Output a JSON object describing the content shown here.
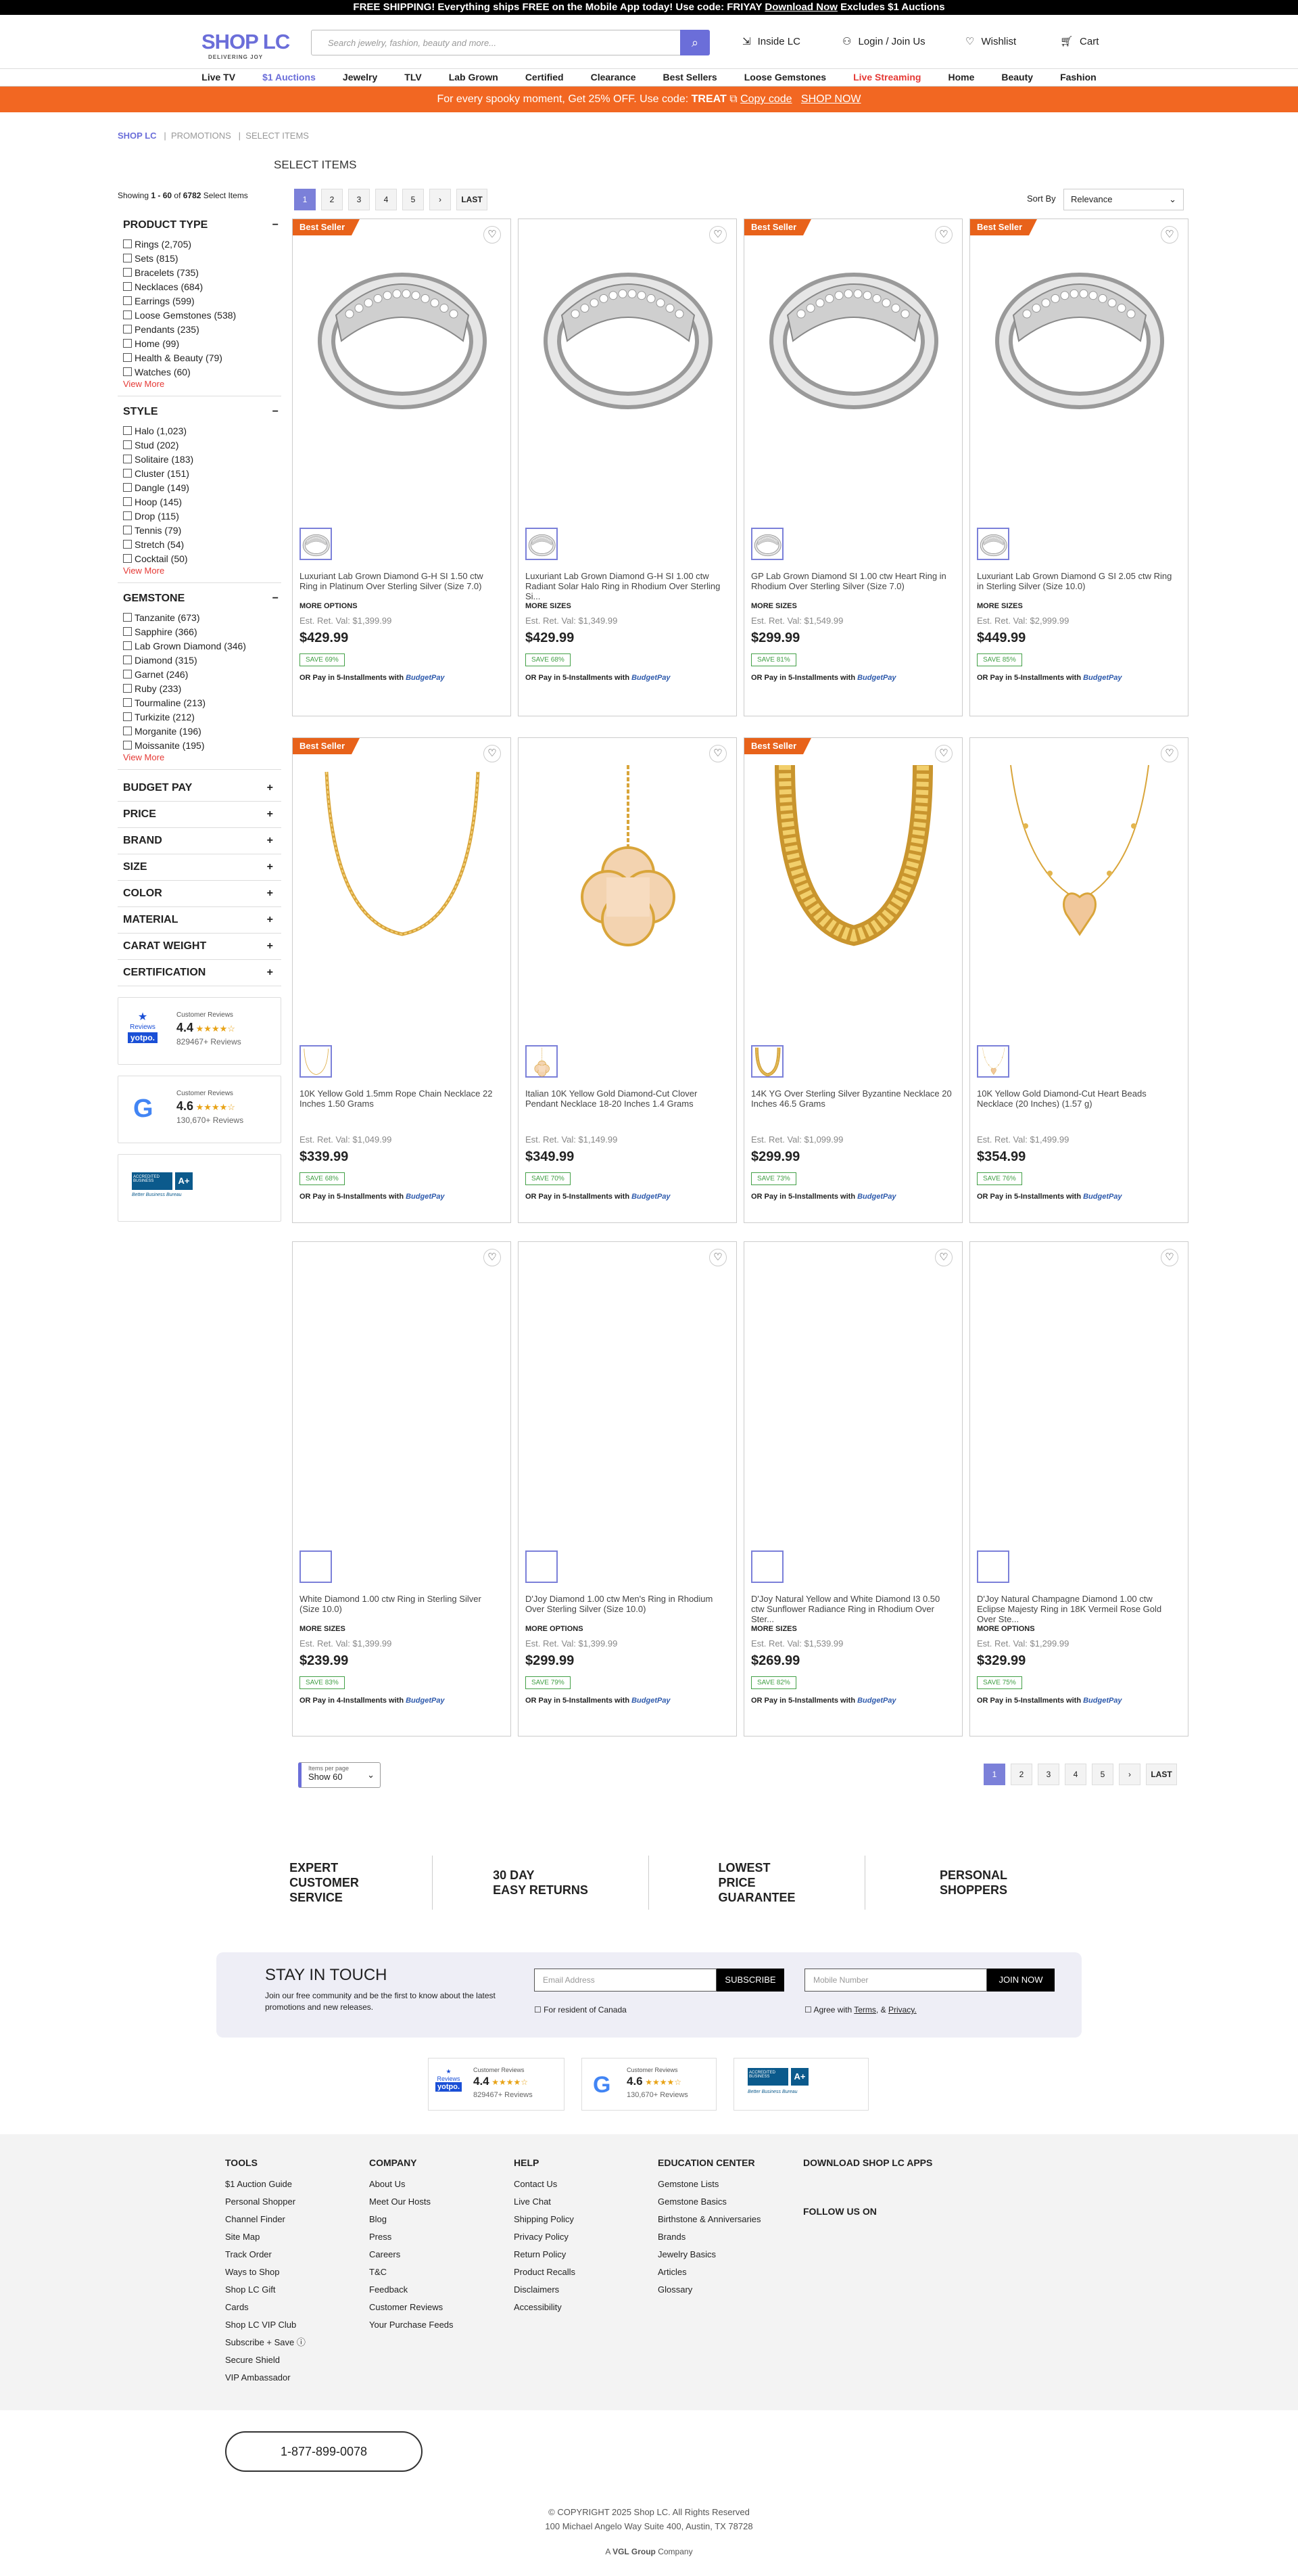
{
  "announcement": {
    "text": "FREE SHIPPING! Everything ships FREE on the Mobile App today! Use code: FRIYAY ",
    "link": "Download Now",
    "tail": " Excludes $1 Auctions"
  },
  "header": {
    "logo": "SHOP LC",
    "tagline": "DELIVERING JOY",
    "search_placeholder": "Search jewelry, fashion, beauty and more...",
    "inside": "Inside LC",
    "login": "Login / Join Us",
    "wishlist": "Wishlist",
    "cart": "Cart"
  },
  "nav": [
    {
      "label": "Live TV",
      "color": "#222"
    },
    {
      "label": "$1 Auctions",
      "color": "#6b6ed9"
    },
    {
      "label": "Jewelry",
      "color": "#222"
    },
    {
      "label": "TLV",
      "color": "#222"
    },
    {
      "label": "Lab Grown",
      "color": "#222"
    },
    {
      "label": "Certified",
      "color": "#222"
    },
    {
      "label": "Clearance",
      "color": "#222"
    },
    {
      "label": "Best Sellers",
      "color": "#222"
    },
    {
      "label": "Loose Gemstones",
      "color": "#222"
    },
    {
      "label": "Live Streaming",
      "color": "#e53935"
    },
    {
      "label": "Home",
      "color": "#222"
    },
    {
      "label": "Beauty",
      "color": "#222"
    },
    {
      "label": "Fashion",
      "color": "#222"
    }
  ],
  "promo": {
    "text": "For every spooky moment, Get 25% OFF. Use code: ",
    "code": "TREAT",
    "copy": "Copy code",
    "shop": "SHOP NOW"
  },
  "breadcrumb": [
    "SHOP LC",
    "PROMOTIONS",
    "SELECT ITEMS"
  ],
  "page_title": "SELECT ITEMS",
  "showing": {
    "a": "Showing ",
    "b": "1 - 60",
    "c": " of ",
    "d": "6782",
    "e": " Select Items"
  },
  "filters": [
    {
      "title": "PRODUCT TYPE",
      "items": [
        "Rings (2,705)",
        "Sets (815)",
        "Bracelets (735)",
        "Necklaces (684)",
        "Earrings (599)",
        "Loose Gemstones (538)",
        "Pendants (235)",
        "Home (99)",
        "Health & Beauty (79)",
        "Watches (60)"
      ]
    },
    {
      "title": "STYLE",
      "items": [
        "Halo (1,023)",
        "Stud (202)",
        "Solitaire (183)",
        "Cluster (151)",
        "Dangle (149)",
        "Hoop (145)",
        "Drop (115)",
        "Tennis (79)",
        "Stretch (54)",
        "Cocktail (50)"
      ]
    },
    {
      "title": "GEMSTONE",
      "items": [
        "Tanzanite (673)",
        "Sapphire (366)",
        "Lab Grown Diamond (346)",
        "Diamond (315)",
        "Garnet (246)",
        "Ruby (233)",
        "Tourmaline (213)",
        "Turkizite (212)",
        "Morganite (196)",
        "Moissanite (195)"
      ]
    }
  ],
  "view_more": "View More",
  "collapsed_filters": [
    "BUDGET PAY",
    "PRICE",
    "BRAND",
    "SIZE",
    "COLOR",
    "MATERIAL",
    "CARAT WEIGHT",
    "CERTIFICATION"
  ],
  "badges": {
    "yotpo": {
      "label": "Customer Reviews",
      "score": "4.4",
      "stars": "★★★★☆",
      "reviews": "829467+ Reviews",
      "brand": "yotpo.",
      "icon_label": "Reviews"
    },
    "google": {
      "label": "Customer Reviews",
      "score": "4.6",
      "stars": "★★★★☆",
      "reviews": "130,670+ Reviews"
    },
    "bbb": {
      "line1": "ACCREDITED BUSINESS",
      "grade": "A+",
      "line2": "Better Business Bureau"
    }
  },
  "pagination": [
    "1",
    "2",
    "3",
    "4",
    "5",
    "›",
    "LAST"
  ],
  "sort": {
    "label": "Sort By",
    "value": "Relevance"
  },
  "products": [
    {
      "best": "Best Seller",
      "name": "Luxuriant Lab Grown Diamond G-H SI 1.50 ctw Ring in Platinum Over Sterling Silver (Size 7.0)",
      "opt": "MORE OPTIONS",
      "est": "Est. Ret. Val: $1,399.99",
      "price": "$429.99",
      "save": "SAVE 69%",
      "bp": "OR Pay in 5-Installments with ",
      "bpbrand": "BudgetPay",
      "img": "ring"
    },
    {
      "best": "",
      "name": "Luxuriant Lab Grown Diamond G-H SI 1.00 ctw Radiant Solar Halo Ring in Rhodium Over Sterling Si...",
      "opt": "MORE SIZES",
      "est": "Est. Ret. Val: $1,349.99",
      "price": "$429.99",
      "save": "SAVE 68%",
      "bp": "OR Pay in 5-Installments with ",
      "bpbrand": "BudgetPay",
      "img": "ring"
    },
    {
      "best": "Best Seller",
      "name": "GP Lab Grown Diamond SI 1.00 ctw Heart Ring in Rhodium Over Sterling Silver (Size 7.0)",
      "opt": "MORE SIZES",
      "est": "Est. Ret. Val: $1,549.99",
      "price": "$299.99",
      "save": "SAVE 81%",
      "bp": "OR Pay in 5-Installments with ",
      "bpbrand": "BudgetPay",
      "img": "ring"
    },
    {
      "best": "Best Seller",
      "name": "Luxuriant Lab Grown Diamond G SI 2.05 ctw Ring in Sterling Silver (Size 10.0)",
      "opt": "MORE SIZES",
      "est": "Est. Ret. Val: $2,999.99",
      "price": "$449.99",
      "save": "SAVE 85%",
      "bp": "OR Pay in 5-Installments with ",
      "bpbrand": "BudgetPay",
      "img": "ring"
    },
    {
      "best": "Best Seller",
      "name": "10K Yellow Gold 1.5mm Rope Chain Necklace 22 Inches 1.50 Grams",
      "opt": "",
      "est": "Est. Ret. Val: $1,049.99",
      "price": "$339.99",
      "save": "SAVE 68%",
      "bp": "OR Pay in 5-Installments with ",
      "bpbrand": "BudgetPay",
      "img": "chain"
    },
    {
      "best": "",
      "name": "Italian 10K Yellow Gold Diamond-Cut Clover Pendant Necklace 18-20 Inches 1.4 Grams",
      "opt": "",
      "est": "Est. Ret. Val: $1,149.99",
      "price": "$349.99",
      "save": "SAVE 70%",
      "bp": "OR Pay in 5-Installments with ",
      "bpbrand": "BudgetPay",
      "img": "pendant"
    },
    {
      "best": "Best Seller",
      "name": "14K YG Over Sterling Silver Byzantine Necklace 20 Inches 46.5 Grams",
      "opt": "",
      "est": "Est. Ret. Val: $1,099.99",
      "price": "$299.99",
      "save": "SAVE 73%",
      "bp": "OR Pay in 5-Installments with ",
      "bpbrand": "BudgetPay",
      "img": "byz"
    },
    {
      "best": "",
      "name": "10K Yellow Gold Diamond-Cut Heart Beads Necklace (20 Inches) (1.57 g)",
      "opt": "",
      "est": "Est. Ret. Val: $1,499.99",
      "price": "$354.99",
      "save": "SAVE 76%",
      "bp": "OR Pay in 5-Installments with ",
      "bpbrand": "BudgetPay",
      "img": "heart"
    },
    {
      "best": "",
      "name": "White Diamond 1.00 ctw Ring in Sterling Silver (Size 10.0)",
      "opt": "MORE SIZES",
      "est": "Est. Ret. Val: $1,399.99",
      "price": "$239.99",
      "save": "SAVE 83%",
      "bp": "OR Pay in 4-Installments with ",
      "bpbrand": "BudgetPay",
      "img": "none"
    },
    {
      "best": "",
      "name": "D'Joy Diamond 1.00 ctw Men's Ring in Rhodium Over Sterling Silver (Size 10.0)",
      "opt": "MORE OPTIONS",
      "est": "Est. Ret. Val: $1,399.99",
      "price": "$299.99",
      "save": "SAVE 79%",
      "bp": "OR Pay in 5-Installments with ",
      "bpbrand": "BudgetPay",
      "img": "none"
    },
    {
      "best": "",
      "name": "D'Joy Natural Yellow and White Diamond I3 0.50 ctw Sunflower Radiance Ring in Rhodium Over Ster...",
      "opt": "MORE SIZES",
      "est": "Est. Ret. Val: $1,539.99",
      "price": "$269.99",
      "save": "SAVE 82%",
      "bp": "OR Pay in 5-Installments with ",
      "bpbrand": "BudgetPay",
      "img": "none"
    },
    {
      "best": "",
      "name": "D'Joy Natural Champagne Diamond 1.00 ctw Eclipse Majesty Ring in 18K Vermeil Rose Gold Over Ste...",
      "opt": "MORE OPTIONS",
      "est": "Est. Ret. Val: $1,299.99",
      "price": "$329.99",
      "save": "SAVE 75%",
      "bp": "OR Pay in 5-Installments with ",
      "bpbrand": "BudgetPay",
      "img": "none"
    }
  ],
  "items_per_page": {
    "label": "Items per page",
    "value": "Show 60"
  },
  "value_props": [
    [
      "EXPERT",
      "CUSTOMER",
      "SERVICE"
    ],
    [
      "30 DAY",
      "EASY RETURNS"
    ],
    [
      "LOWEST",
      "PRICE",
      "GUARANTEE"
    ],
    [
      "PERSONAL",
      "SHOPPERS"
    ]
  ],
  "stay": {
    "title": "STAY IN TOUCH",
    "desc": "Join our free community and be the first to know about the latest promotions and new releases.",
    "email_ph": "Email Address",
    "subscribe": "SUBSCRIBE",
    "canada": "For resident of Canada",
    "mobile_ph": "Mobile Number",
    "join": "JOIN NOW",
    "agree": "Agree with ",
    "terms": "Terms",
    "amp": ", & ",
    "privacy": "Privacy."
  },
  "footer_cols": [
    {
      "title": "TOOLS",
      "links": [
        "$1 Auction Guide",
        "Personal Shopper",
        "Channel Finder",
        "Site Map",
        "Track Order",
        "Ways to Shop",
        "Shop LC Gift",
        "Cards",
        "Shop LC VIP Club",
        "Subscribe + Save ⓘ",
        "Secure Shield",
        "VIP Ambassador"
      ]
    },
    {
      "title": "COMPANY",
      "links": [
        "About Us",
        "Meet Our Hosts",
        "Blog",
        "Press",
        "Careers",
        "T&C",
        "Feedback",
        "Customer Reviews",
        "Your Purchase Feeds"
      ]
    },
    {
      "title": "HELP",
      "links": [
        "Contact Us",
        "Live Chat",
        "Shipping Policy",
        "Privacy Policy",
        "Return Policy",
        "Product Recalls",
        "Disclaimers",
        "Accessibility"
      ]
    },
    {
      "title": "EDUCATION CENTER",
      "links": [
        "Gemstone Lists",
        "Gemstone Basics",
        "Birthstone & Anniversaries",
        "Brands",
        "Jewelry Basics",
        "Articles",
        "Glossary"
      ]
    }
  ],
  "apps_title": "DOWNLOAD SHOP LC APPS",
  "follow_title": "FOLLOW US ON",
  "phone": "1-877-899-0078",
  "copyright": "© COPYRIGHT 2025 Shop LC. All Rights Reserved",
  "address": "100 Michael Angelo Way Suite 400, Austin, TX 78728",
  "vgl": {
    "a": "A ",
    "b": "VGL Group",
    "c": " Company"
  },
  "colors": {
    "brand": "#6b6ed9",
    "promo": "#f26722",
    "bestseller": "#e8621a"
  }
}
